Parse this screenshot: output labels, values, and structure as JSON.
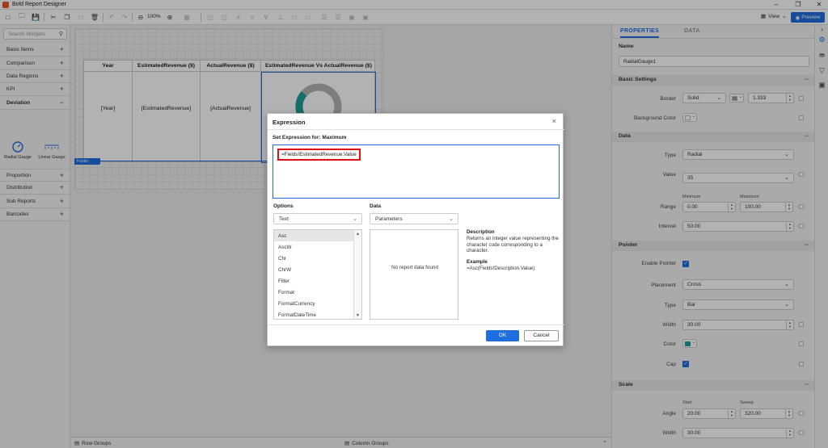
{
  "app": {
    "title": "Bold Report Designer"
  },
  "window_controls": {
    "minimize": "–",
    "restore": "❐",
    "close": "✕"
  },
  "toolbar": {
    "zoom": "100%",
    "view_label": "View",
    "preview_label": "Preview"
  },
  "left_panel": {
    "search_placeholder": "Search Widgets",
    "categories": [
      {
        "label": "Basic Items",
        "sign": "+"
      },
      {
        "label": "Comparison",
        "sign": "+"
      },
      {
        "label": "Data Regions",
        "sign": "+"
      },
      {
        "label": "KPI",
        "sign": "+"
      },
      {
        "label": "Deviation",
        "sign": "−"
      },
      {
        "label": "Proportion",
        "sign": "+"
      },
      {
        "label": "Distribution",
        "sign": "+"
      },
      {
        "label": "Sub Reports",
        "sign": "+"
      },
      {
        "label": "Barcodes",
        "sign": "+"
      }
    ],
    "widgets": [
      {
        "label": "Radial Gauge"
      },
      {
        "label": "Linear Gauge"
      }
    ]
  },
  "report": {
    "headers": [
      "Year",
      "EstimatedRevenue ($)",
      "ActualRevenue ($)",
      "EstimatedRevenue Vs ActualRevenue ($)"
    ],
    "cells": [
      "[Year]",
      "[EstimatedRevenue]",
      "[ActualRevenue]"
    ],
    "footer_tag": "Footer"
  },
  "bottom_bar": {
    "row_groups": "Row Groups",
    "column_groups": "Column Groups"
  },
  "properties": {
    "tabs": [
      "PROPERTIES",
      "DATA"
    ],
    "name_section": "Name",
    "name_value": "RadialGauge1",
    "basic_settings": {
      "title": "Basic Settings",
      "border_label": "Border",
      "border_style": "Solid",
      "border_width": "1.333",
      "background_label": "Background Color"
    },
    "data": {
      "title": "Data",
      "type_label": "Type",
      "type_value": "Radial",
      "value_label": "Value",
      "value_value": "35",
      "range_label": "Range",
      "range_min_label": "Minimum",
      "range_max_label": "Maximum",
      "range_min": "0.00",
      "range_max": "100.00",
      "interval_label": "Interval",
      "interval_value": "50.00"
    },
    "pointer": {
      "title": "Pointer",
      "enable_label": "Enable Pointer",
      "placement_label": "Placement",
      "placement_value": "Cross",
      "type_label": "Type",
      "type_value": "Bar",
      "width_label": "Width",
      "width_value": "30.00",
      "color_label": "Color",
      "cap_label": "Cap"
    },
    "scale": {
      "title": "Scale",
      "start_label": "Start",
      "sweep_label": "Sweep",
      "angle_label": "Angle",
      "angle_start": "20.00",
      "angle_sweep": "320.00",
      "width_label": "Width",
      "width_value": "30.00"
    }
  },
  "dialog": {
    "title": "Expression",
    "set_expression": "Set Expression for: Maximum",
    "expression": "=Fields!EstimatedRevenue.Value",
    "options_label": "Options",
    "options_value": "Text",
    "data_label": "Data",
    "data_value": "Parameters",
    "functions": [
      "Asc",
      "AscW",
      "Chr",
      "ChrW",
      "Filter",
      "Format",
      "FormatCurrency",
      "FormatDateTime"
    ],
    "no_data": "No report data found",
    "description_heading": "Description",
    "description": "Returns an integer value representing the character code corresponding to a character.",
    "example_heading": "Example",
    "example": "=Asc(Fields!Description.Value)",
    "ok": "OK",
    "cancel": "Cancel"
  },
  "colors": {
    "accent": "#1f6fe0",
    "highlight": "#e01010",
    "gauge_teal": "#1f9e96",
    "gauge_gray": "#b5b5b5"
  }
}
